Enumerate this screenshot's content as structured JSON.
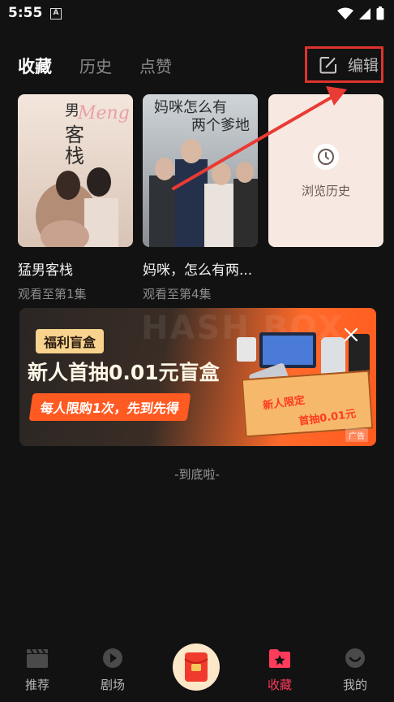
{
  "status_bar": {
    "time": "5:55",
    "notification_letter": "A"
  },
  "tabs": [
    {
      "label": "收藏",
      "active": true
    },
    {
      "label": "历史",
      "active": false
    },
    {
      "label": "点赞",
      "active": false
    }
  ],
  "edit": {
    "label": "编辑",
    "icon": "edit-icon"
  },
  "cards": [
    {
      "title": "猛男客栈",
      "progress": "观看至第1集",
      "poster_title": "猛男客栈"
    },
    {
      "title": "妈咪，怎么有两...",
      "progress": "观看至第4集",
      "poster_title": "妈咪怎么有两个爹地"
    }
  ],
  "history_card": {
    "label": "浏览历史",
    "icon": "clock-icon"
  },
  "banner": {
    "tag": "福利盲盒",
    "headline": "新人首抽0.01元盲盒",
    "pill": "每人限购1次，先到先得",
    "bg_text": "HASH BOX",
    "box_text_a": "新人限定",
    "box_text_b": "首抽0.01元",
    "ad_label": "广告"
  },
  "end_text": "-到底啦-",
  "nav": [
    {
      "label": "推荐",
      "icon": "clapperboard-icon",
      "active": false
    },
    {
      "label": "剧场",
      "icon": "play-circle-icon",
      "active": false
    },
    {
      "label": "收藏",
      "icon": "folder-star-icon",
      "active": true
    },
    {
      "label": "我的",
      "icon": "smile-icon",
      "active": false
    }
  ],
  "colors": {
    "accent": "#ff3b5c",
    "annotation_red": "#e0332d",
    "background": "#121212"
  }
}
